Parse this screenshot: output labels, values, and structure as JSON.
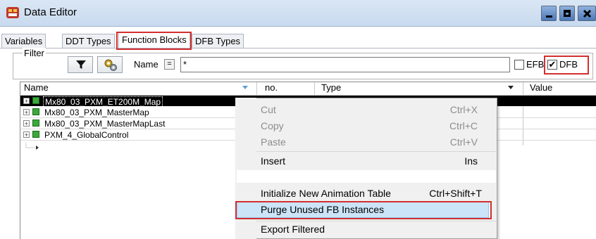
{
  "window": {
    "title": "Data Editor",
    "icon": "data-editor-app-icon",
    "buttons": [
      "minimize",
      "maximize",
      "close"
    ]
  },
  "tabs": [
    {
      "label": "Variables",
      "active": false
    },
    {
      "label": "DDT Types",
      "active": false
    },
    {
      "label": "Function Blocks",
      "active": true
    },
    {
      "label": "DFB Types",
      "active": false
    }
  ],
  "filter": {
    "legend": "Filter",
    "name_label": "Name",
    "eq_symbol": "=",
    "value": "*",
    "efb_label": "EFB",
    "efb_checked": false,
    "dfb_label": "DFB",
    "dfb_checked": true,
    "dfb_check_glyph": "✔"
  },
  "grid": {
    "columns": [
      "Name",
      "no.",
      "Type",
      "Value"
    ],
    "rows": [
      {
        "name": "Mx80_03_PXM_ET200M_Map",
        "selected": true
      },
      {
        "name": "Mx80_03_PXM_MasterMap",
        "selected": false
      },
      {
        "name": "Mx80_03_PXM_MasterMapLast",
        "selected": false
      },
      {
        "name": "PXM_4_GlobalControl",
        "selected": false
      }
    ],
    "expander_glyph": "+"
  },
  "context_menu": {
    "items": [
      {
        "label": "Cut",
        "shortcut": "Ctrl+X",
        "enabled": false
      },
      {
        "label": "Copy",
        "shortcut": "Ctrl+C",
        "enabled": false
      },
      {
        "label": "Paste",
        "shortcut": "Ctrl+V",
        "enabled": false
      },
      {
        "label": "Insert",
        "shortcut": "Ins",
        "enabled": true
      },
      {
        "label": "Initialize New Animation Table",
        "shortcut": "Ctrl+Shift+T",
        "enabled": true
      },
      {
        "label": "Purge Unused FB Instances",
        "shortcut": "",
        "enabled": true,
        "highlighted": true
      },
      {
        "label": "Export Filtered",
        "shortcut": "",
        "enabled": true
      }
    ]
  },
  "colors": {
    "highlight_border": "#d32f2f",
    "selection": "#000000",
    "menu_hover": "#cce4f7"
  }
}
